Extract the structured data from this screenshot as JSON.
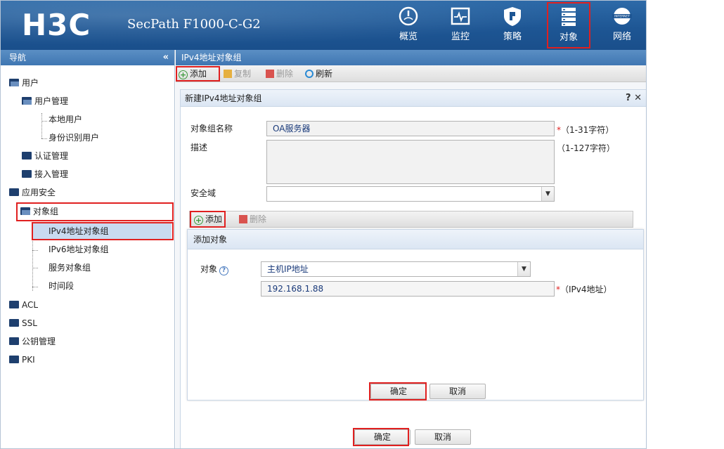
{
  "header": {
    "logo": "H3C",
    "product": "SecPath F1000-C-G2",
    "nav": [
      {
        "label": "概览",
        "icon": "dashboard-icon"
      },
      {
        "label": "监控",
        "icon": "monitor-icon"
      },
      {
        "label": "策略",
        "icon": "shield-icon"
      },
      {
        "label": "对象",
        "icon": "server-stack-icon",
        "active": true
      },
      {
        "label": "网络",
        "icon": "internet-globe-icon",
        "badge": "INTERNET"
      }
    ]
  },
  "sidebar": {
    "title": "导航",
    "collapse": "«",
    "items": [
      {
        "label": "用户"
      },
      {
        "label": "用户管理"
      },
      {
        "label": "本地用户"
      },
      {
        "label": "身份识别用户"
      },
      {
        "label": "认证管理"
      },
      {
        "label": "接入管理"
      },
      {
        "label": "应用安全"
      },
      {
        "label": "对象组"
      },
      {
        "label": "IPv4地址对象组"
      },
      {
        "label": "IPv6地址对象组"
      },
      {
        "label": "服务对象组"
      },
      {
        "label": "时间段"
      },
      {
        "label": "ACL"
      },
      {
        "label": "SSL"
      },
      {
        "label": "公钥管理"
      },
      {
        "label": "PKI"
      }
    ]
  },
  "main": {
    "title": "IPv4地址对象组",
    "toolbar": {
      "add": "添加",
      "copy": "复制",
      "delete": "删除",
      "refresh": "刷新"
    }
  },
  "dialog": {
    "title": "新建IPv4地址对象组",
    "tools": "? ✕",
    "name_label": "对象组名称",
    "name_value": "OA服务器",
    "name_hint": "（1-31字符）",
    "desc_label": "描述",
    "desc_value": "",
    "desc_hint": "（1-127字符）",
    "zone_label": "安全域",
    "zone_value": "",
    "sub_add": "添加",
    "sub_delete": "删除",
    "ok": "确定",
    "cancel": "取消",
    "required_mark": "*"
  },
  "add_object": {
    "title": "添加对象",
    "object_label": "对象",
    "object_type": "主机IP地址",
    "ip_value": "192.168.1.88",
    "ip_hint": "（IPv4地址）",
    "ok": "确定",
    "cancel": "取消"
  },
  "colors": {
    "header": "#1d5593",
    "highlight": "#e02020",
    "selected": "#c9daf0"
  }
}
